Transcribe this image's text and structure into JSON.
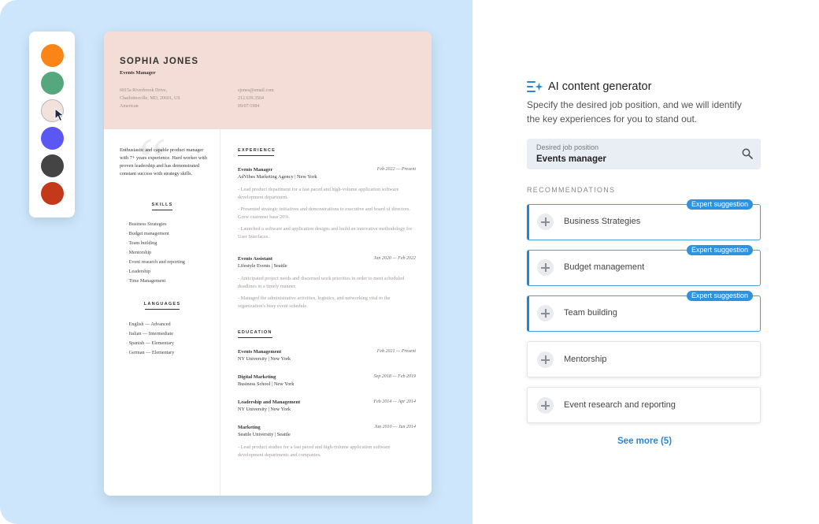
{
  "palette": {
    "swatches": [
      {
        "color": "#fa8516",
        "selected": false
      },
      {
        "color": "#55a87e",
        "selected": false
      },
      {
        "color": "#f3e1dc",
        "selected": true
      },
      {
        "color": "#5b57f3",
        "selected": false
      },
      {
        "color": "#444444",
        "selected": false
      },
      {
        "color": "#c5391b",
        "selected": false
      }
    ]
  },
  "resume": {
    "name": "SOPHIA JONES",
    "role": "Events Manager",
    "address_lines": [
      "6815a Riverbrook Drive,",
      "Charlottesville, MD, 20601, US",
      "American"
    ],
    "contact_lines": [
      "sjones@email.com",
      "212.639.3564",
      "09/07/1984"
    ],
    "summary": "Enthusiastic and capable product manager with 7+ years experience. Hard worker with proven leadership and has demonstrated constant success with strategy skills.",
    "skills_title": "SKILLS",
    "skills": [
      "Business Strategies",
      "Budget management",
      "Team building",
      "Mentorship",
      "Event research and reporting",
      "Leadership",
      "Time Management"
    ],
    "languages_title": "LANGUAGES",
    "languages": [
      "English — Advanced",
      "Italian — Intermediate",
      "Spanish — Elementary",
      "German — Elementary"
    ],
    "experience_title": "EXPERIENCE",
    "experience": [
      {
        "title": "Events Manager",
        "date": "Feb 2022 — Present",
        "company": "AdVibes Marketing Agency | New York",
        "points": [
          "- Lead product department for a fast paced and high-volume application software development department.",
          "- Presented strategic initiatives and demonstrations to executive and board of directors. Grew customer base 20%.",
          "- Launched a software and application designs and build an innovative methodology for User Interfaces."
        ]
      },
      {
        "title": "Events Assistant",
        "date": "Jan 2020 — Feb 2022",
        "company": "Lifestyle Events | Seattle",
        "points": [
          "- Anticipated project needs and discerned work priorities in order to meet scheduled deadlines in a timely manner.",
          "- Managed the administrative activities, logistics, and networking vital to the organization's busy event schedule."
        ]
      }
    ],
    "education_title": "EDUCATION",
    "education": [
      {
        "title": "Events Management",
        "date": "Feb 2021 — Present",
        "school": "NY University | New York",
        "note": ""
      },
      {
        "title": "Digital Marketing",
        "date": "Sep 2018 — Feb 2019",
        "school": "Business School | New York",
        "note": ""
      },
      {
        "title": "Leadership and Management",
        "date": "Feb 2014 — Apr 2014",
        "school": "NY University | New York",
        "note": ""
      },
      {
        "title": "Marketing",
        "date": "Jan 2010 — Jun 2014",
        "school": "Seattle University | Seattle",
        "note": "- Lead product studies for a fast paced and high-volume application software development departments and companies."
      }
    ]
  },
  "ai": {
    "title": "AI content generator",
    "description": "Specify the desired job position, and we will identify the key experiences for you to stand out.",
    "search": {
      "label": "Desired job position",
      "value": "Events manager"
    },
    "recommendations_title": "RECOMMENDATIONS",
    "badge_label": "Expert suggestion",
    "recommendations": [
      {
        "label": "Business Strategies",
        "expert": true
      },
      {
        "label": "Budget management",
        "expert": true
      },
      {
        "label": "Team building",
        "expert": true
      },
      {
        "label": "Mentorship",
        "expert": false
      },
      {
        "label": "Event research and reporting",
        "expert": false
      }
    ],
    "see_more": "See more (5)",
    "accent_color": "#2a86d3"
  }
}
